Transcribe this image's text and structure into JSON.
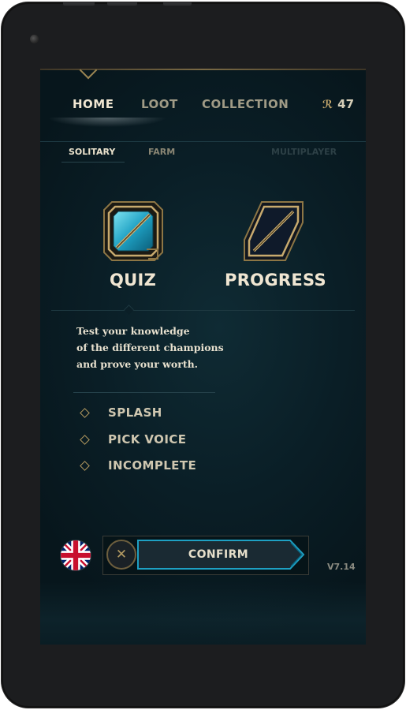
{
  "nav": {
    "home": "HOME",
    "loot": "LOOT",
    "collection": "COLLECTION",
    "currency_symbol": "ℛ",
    "currency_value": "47"
  },
  "subnav": {
    "solitary": "SOLITARY",
    "farm": "FARM",
    "multiplayer": "MULTIPLAYER"
  },
  "modes": {
    "quiz": "QUIZ",
    "progress": "PROGRESS"
  },
  "description": {
    "line1": "Test your knowledge",
    "line2": "of the different champions",
    "line3": "and prove your worth."
  },
  "options": [
    "SPLASH",
    "PICK VOICE",
    "INCOMPLETE"
  ],
  "bottom": {
    "cancel_symbol": "✕",
    "confirm": "CONFIRM",
    "version": "V7.14"
  },
  "icons": {
    "language": "uk-flag-icon",
    "option_marker": "diamond-icon"
  },
  "colors": {
    "gold": "#c8aa6e",
    "text_light": "#f0e6d2",
    "accent_blue": "#1ea0c3",
    "background": "#0a1e26"
  }
}
